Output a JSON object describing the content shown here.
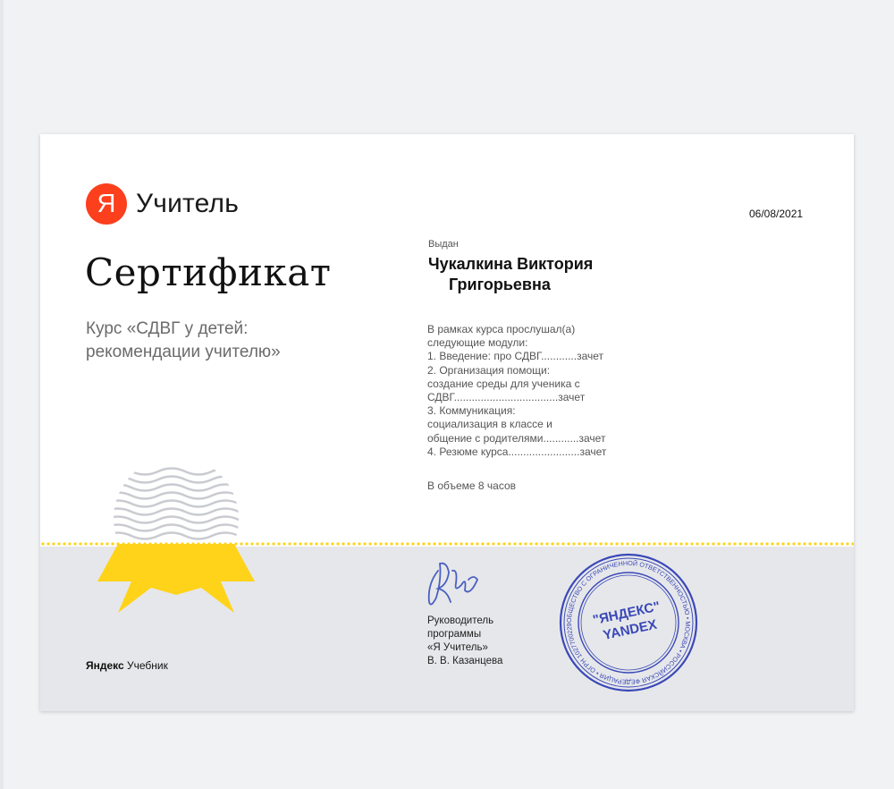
{
  "brand": {
    "logo_letter": "Я",
    "logo_text": "Учитель",
    "logo_color": "#fc3f1d"
  },
  "date": "06/08/2021",
  "title": "Сертификат",
  "course": {
    "line1": "Курс «СДВГ у детей:",
    "line2": "рекомендации учителю»"
  },
  "issued": {
    "label": "Выдан",
    "name_line1": "Чукалкина Виктория",
    "name_line2": "Григорьевна"
  },
  "modules": {
    "lines": [
      "В рамках курса прослушал(а)",
      "следующие модули:",
      "1. Введение: про СДВГ............зачет",
      "2. Организация помощи:",
      "создание среды для ученика с",
      "СДВГ...................................зачет",
      "3. Коммуникация:",
      "социализация в классе и",
      "общение с родителями............зачет",
      "4. Резюме курса........................зачет"
    ]
  },
  "volume": "В объеме 8 часов",
  "director": {
    "line1": "Руководитель",
    "line2": "программы",
    "line3": "«Я Учитель»",
    "line4": "В. В. Казанцева"
  },
  "stamp": {
    "center_line1": "\"ЯНДЕКС\"",
    "center_line2": "YANDEX",
    "ring_text": "ОБЩЕСТВО С ОГРАНИЧЕННОЙ ОТВЕТСТВЕННОСТЬЮ • МОСКВА • РОССИЙСКАЯ ФЕДЕРАЦИЯ • ОГРН 1027700229193 •",
    "color": "#3a48b8"
  },
  "footer": {
    "brand_bold": "Яндекс",
    "brand_rest": " Учебник"
  },
  "colors": {
    "accent_yellow": "#ffd319",
    "band_gray": "#e6e7ea",
    "wave_gray": "#c9cbd1"
  }
}
